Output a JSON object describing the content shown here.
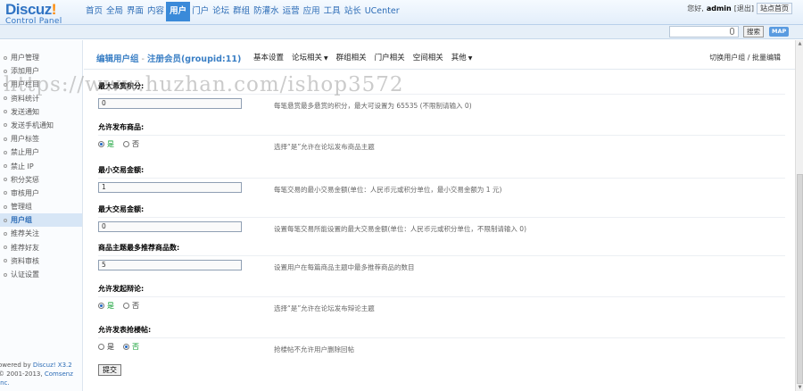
{
  "app": {
    "logo_main": "Discuz",
    "logo_mark": "!",
    "logo_sub": "Control Panel"
  },
  "topnav": {
    "items": [
      "首页",
      "全局",
      "界面",
      "内容",
      "用户",
      "门户",
      "论坛",
      "群组",
      "防灌水",
      "运营",
      "应用",
      "工具",
      "站长",
      "UCenter"
    ],
    "active_index": 4
  },
  "user": {
    "greeting": "您好,",
    "name": "admin",
    "logout": "[退出]",
    "site_home": "站点首页"
  },
  "search": {
    "value": "",
    "button": "搜索",
    "map_button": "MAP"
  },
  "sidebar": {
    "items": [
      {
        "label": "用户管理"
      },
      {
        "label": "添加用户"
      },
      {
        "label": "用户栏目"
      },
      {
        "label": "资料统计"
      },
      {
        "label": "发送通知"
      },
      {
        "label": "发送手机通知"
      },
      {
        "label": "用户标签"
      },
      {
        "label": "禁止用户"
      },
      {
        "label": "禁止 IP"
      },
      {
        "label": "积分奖惩"
      },
      {
        "label": "审核用户"
      },
      {
        "label": "管理组"
      },
      {
        "label": "用户组"
      },
      {
        "label": "推荐关注"
      },
      {
        "label": "推荐好友"
      },
      {
        "label": "资料审核"
      },
      {
        "label": "认证设置"
      }
    ],
    "active_index": 12,
    "footer_line1_prefix": "owered by ",
    "footer_line1_link": "Discuz! X3.2",
    "footer_line2_prefix": "© 2001-2013, ",
    "footer_line2_link": "Comsenz Inc."
  },
  "page": {
    "title": "编辑用户组",
    "title_sep": "-",
    "group_name": "注册会员(groupid:11)",
    "tabs": [
      {
        "label": "基本设置",
        "dropdown": false
      },
      {
        "label": "论坛相关",
        "dropdown": true
      },
      {
        "label": "群组相关",
        "dropdown": false
      },
      {
        "label": "门户相关",
        "dropdown": false
      },
      {
        "label": "空间相关",
        "dropdown": false
      },
      {
        "label": "其他",
        "dropdown": true
      }
    ],
    "right_link": "切换用户组 / 批量编辑",
    "watermark": "https://www.huzhan.com/ishop3572"
  },
  "form": {
    "rows": [
      {
        "label": "最大悬赏积分:",
        "type": "text",
        "value": "0",
        "tip": "每笔悬赏最多悬赏的积分，最大可设置为 65535 (不限制请输入 0)"
      },
      {
        "label": "允许发布商品:",
        "type": "radio",
        "yes": "是",
        "no": "否",
        "selected": "yes",
        "tip": "选择“是”允许在论坛发布商品主题"
      },
      {
        "label": "最小交易金额:",
        "type": "text",
        "value": "1",
        "tip": "每笔交易的最小交易金额(单位：人民币元或积分单位，最小交易金额为 1 元)"
      },
      {
        "label": "最大交易金额:",
        "type": "text",
        "value": "0",
        "tip": "设置每笔交易所能设置的最大交易金额(单位：人民币元或积分单位，不限制请输入 0)"
      },
      {
        "label": "商品主题最多推荐商品数:",
        "type": "text",
        "value": "5",
        "tip": "设置用户在每篇商品主题中最多推荐商品的数目"
      },
      {
        "label": "允许发起辩论:",
        "type": "radio",
        "yes": "是",
        "no": "否",
        "selected": "yes",
        "tip": "选择“是”允许在论坛发布辩论主题"
      },
      {
        "label": "允许发表抢楼帖:",
        "type": "radio",
        "yes": "是",
        "no": "否",
        "selected": "no",
        "tip": "抢楼帖不允许用户删除回帖"
      }
    ],
    "submit": "提交"
  }
}
